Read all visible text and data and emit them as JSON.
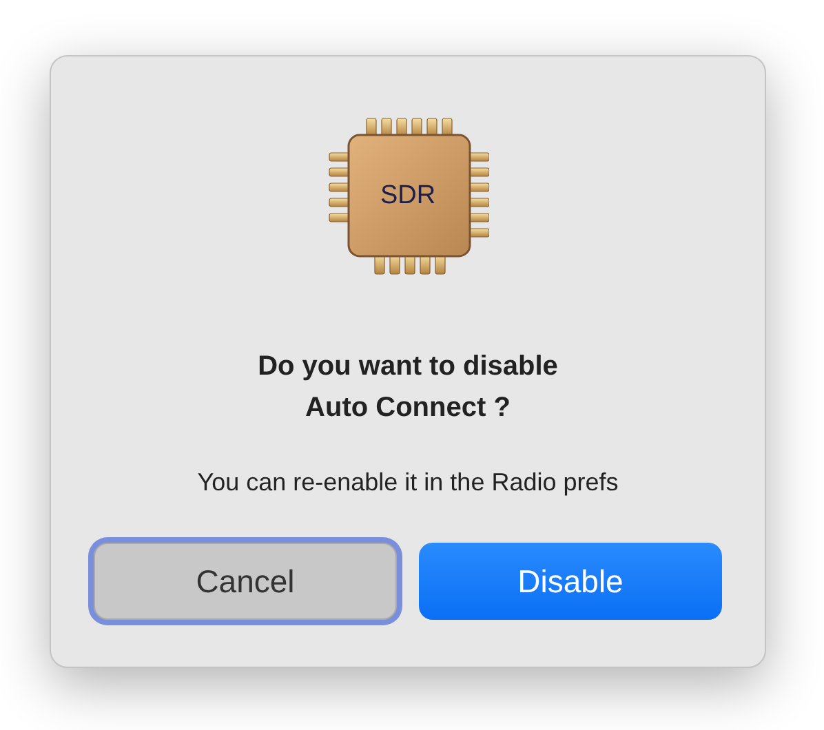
{
  "dialog": {
    "icon_label": "SDR",
    "title": "Do you want to disable\nAuto Connect ?",
    "message": "You can re-enable it in the Radio prefs",
    "buttons": [
      {
        "label": "Cancel",
        "kind": "secondary",
        "focused": true
      },
      {
        "label": "Disable",
        "kind": "primary",
        "focused": false
      }
    ]
  }
}
